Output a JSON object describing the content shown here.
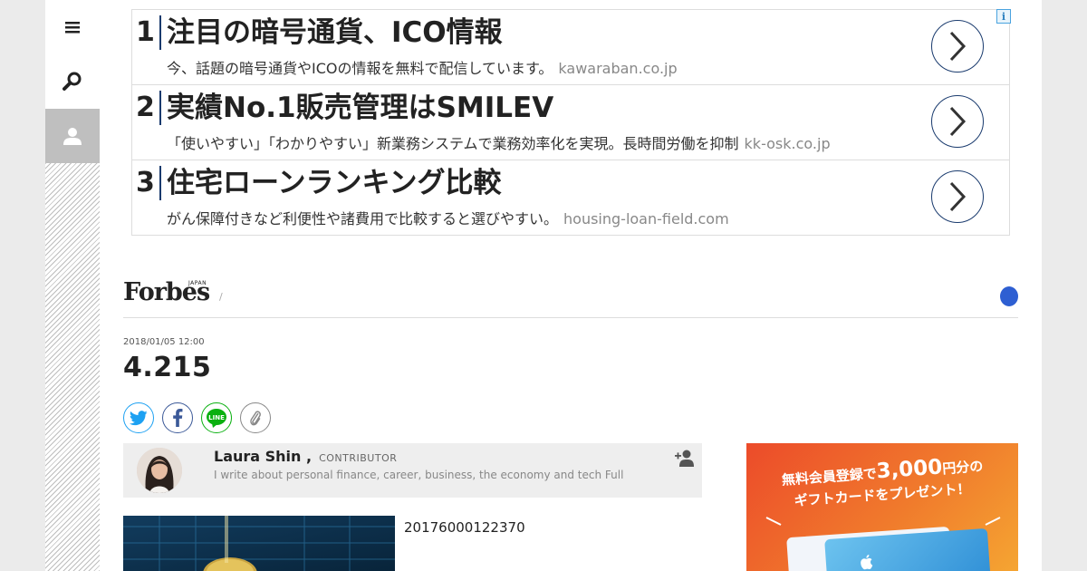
{
  "rail": {
    "menu_icon": "hamburger-menu-icon",
    "search_icon": "magnifier-icon",
    "user_icon": "user-silhouette-icon"
  },
  "ads": [
    {
      "num": "1",
      "title": "注目の暗号通貨、ICO情報",
      "desc": "今、話題の暗号通貨やICOの情報を無料で配信しています。",
      "domain": "kawaraban.co.jp"
    },
    {
      "num": "2",
      "title": "実績No.1販売管理はSMILEV",
      "desc": "「使いやすい」「わかりやすい」新業務システムで業務効率化を実現。長時間労働を抑制",
      "domain": "kk-osk.co.jp"
    },
    {
      "num": "3",
      "title": "住宅ローンランキング比較",
      "desc": "がん保障付きなど利便性や諸費用で比較すると選びやすい。",
      "domain": "housing-loan-field.com"
    }
  ],
  "header": {
    "logo": "Forbes",
    "logo_sub": "JAPAN",
    "crumb_sep": "/"
  },
  "article": {
    "date": "2018/01/05 12:00",
    "title": "4.215",
    "image_caption": "20176000122370"
  },
  "author": {
    "name": "Laura Shin ,",
    "role": "CONTRIBUTOR",
    "bio": "I write about personal finance, career, business, the economy and tech Full"
  },
  "banner": {
    "line1_pre": "無料会員登録で",
    "line1_big": "3,000",
    "line1_post": "円分の",
    "line2": "ギフトカードをプレゼント！"
  },
  "colors": {
    "accent_navy": "#1a3b6e",
    "twitter": "#1da1f2",
    "facebook": "#3b5998",
    "line": "#0ab010",
    "blue_dot": "#2e5fd2",
    "banner_orange": "#ec4b2a"
  }
}
